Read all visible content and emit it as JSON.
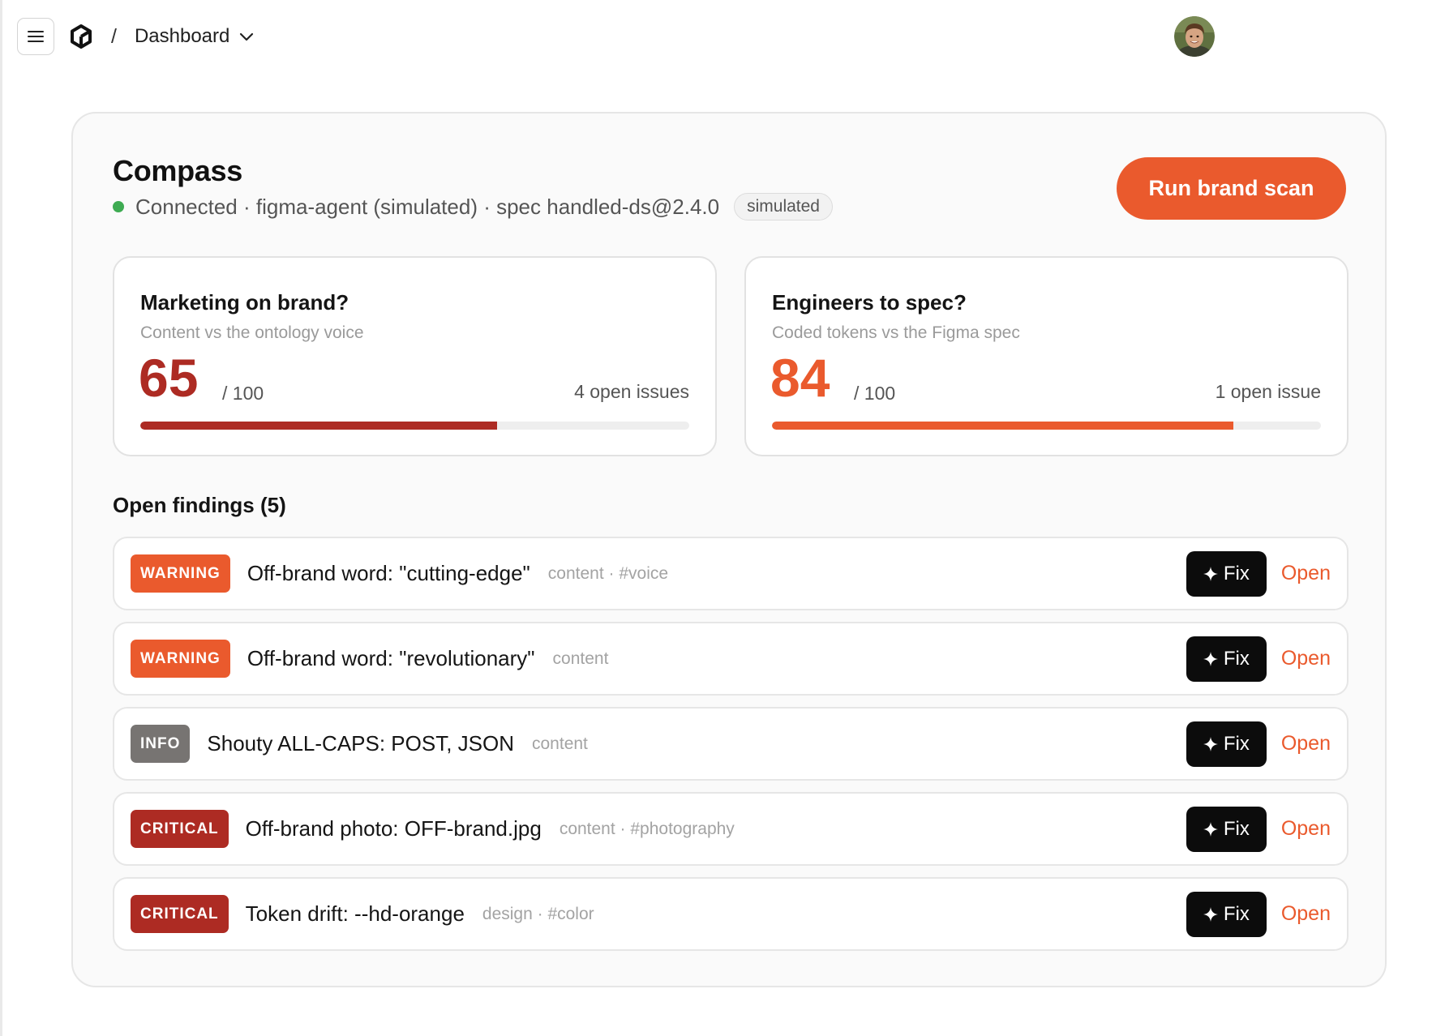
{
  "header": {
    "separator": "/",
    "breadcrumb": "Dashboard",
    "icons": {
      "menu": "menu-icon",
      "logo": "logo-icon",
      "breadcrumb_toggle": "chevron-down-icon",
      "avatar": "user-avatar"
    }
  },
  "compass": {
    "title": "Compass",
    "status": "Connected · figma-agent (simulated) · spec handled-ds@2.4.0",
    "status_color": "#3eab52",
    "badge": "simulated",
    "run_button": "Run brand scan",
    "accent_color": "#ea5a2d"
  },
  "scores": {
    "marketing": {
      "title": "Marketing on brand?",
      "subtitle": "Content vs the ontology voice",
      "value": "65",
      "out_of": "/ 100",
      "progress": 0.65,
      "issues": "4 open issues",
      "color": "#ad2b23"
    },
    "engineering": {
      "title": "Engineers to spec?",
      "subtitle": "Coded tokens vs the Figma spec",
      "value": "84",
      "out_of": "/ 100",
      "progress": 0.84,
      "issues": "1 open issue",
      "color": "#ea5a2d"
    }
  },
  "findings": {
    "title": "Open findings (5)",
    "fix_label": "Fix",
    "open_label": "Open",
    "items": [
      {
        "severity": "WARNING",
        "text": "Off-brand word: \"cutting-edge\"",
        "tags": "content · #voice"
      },
      {
        "severity": "WARNING",
        "text": "Off-brand word: \"revolutionary\"",
        "tags": "content"
      },
      {
        "severity": "INFO",
        "text": "Shouty ALL-CAPS: POST, JSON",
        "tags": "content"
      },
      {
        "severity": "CRITICAL",
        "text": "Off-brand photo: OFF-brand.jpg",
        "tags": "content · #photography"
      },
      {
        "severity": "CRITICAL",
        "text": "Token drift: --hd-orange",
        "tags": "design · #color"
      }
    ]
  }
}
